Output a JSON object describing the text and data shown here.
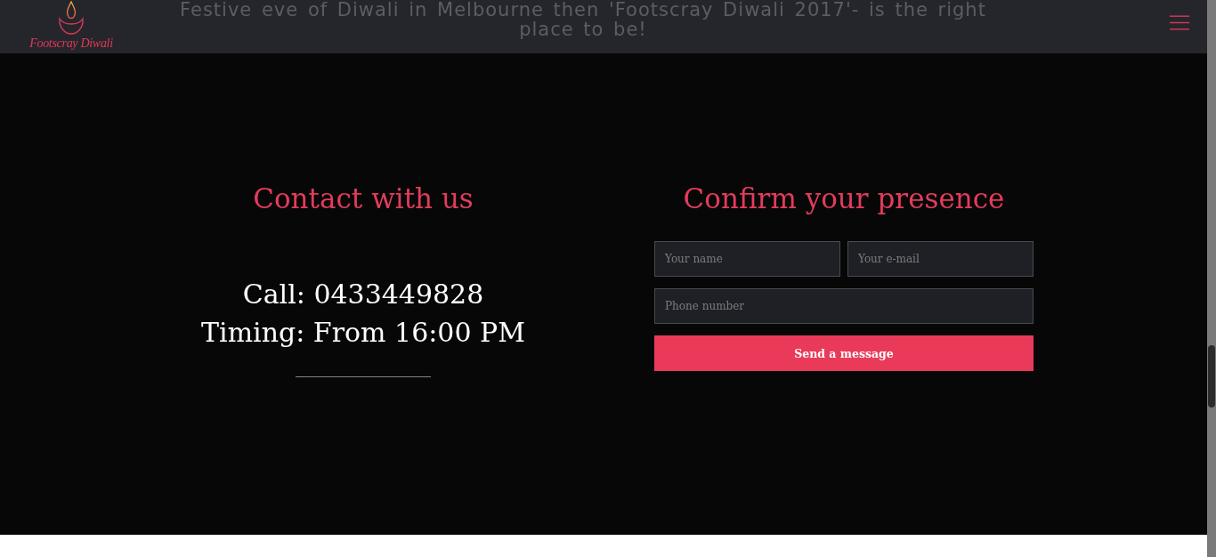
{
  "header": {
    "logo": {
      "text": "Footscray Diwali"
    },
    "tagline": [
      "Festive eve of Diwali in Melbourne then 'Footscray Diwali 2017'- is the right",
      "place to be!"
    ]
  },
  "contact": {
    "title": "Contact with us",
    "lines": [
      "Call: 0433449828",
      "Timing: From 16:00 PM"
    ]
  },
  "rsvp": {
    "title": "Confirm your presence",
    "field_rows": [
      [
        {
          "placeholder": "Your name"
        },
        {
          "placeholder": "Your e-mail"
        }
      ],
      [
        {
          "placeholder": "Phone number"
        }
      ]
    ],
    "button": "Send a message"
  }
}
